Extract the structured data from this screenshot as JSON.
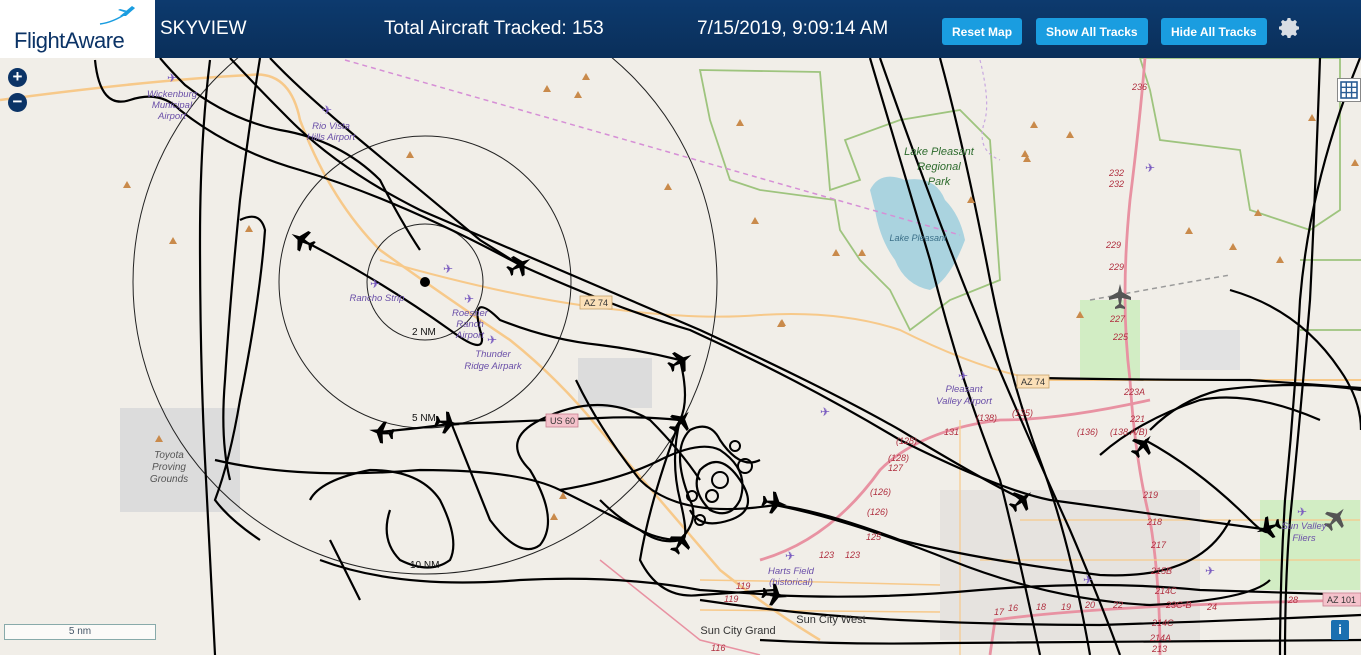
{
  "header": {
    "logo_text": "FlightAware",
    "app_name": "SKYVIEW",
    "total_tracked": "Total Aircraft Tracked: 153",
    "timestamp": "7/15/2019, 9:09:14 AM",
    "reset_label": "Reset Map",
    "show_tracks_label": "Show All Tracks",
    "hide_tracks_label": "Hide All Tracks",
    "settings_icon": "gear-icon"
  },
  "map_controls": {
    "zoom_in": "+",
    "zoom_out": "−",
    "scale_label": "5 nm",
    "info_label": "i",
    "layers_icon": "grid-icon"
  },
  "range_rings": [
    "2 NM",
    "5 NM",
    "10 NM"
  ],
  "places": {
    "wickenburg": [
      "Wickenburg",
      "Municipal",
      "Airport"
    ],
    "rio_vista": [
      "Rio Vista",
      "Hills Airport"
    ],
    "rancho": "Rancho Strip",
    "roesner": [
      "Roesner",
      "Ranch",
      "Airport"
    ],
    "thunder": [
      "Thunder",
      "Ridge Airpark"
    ],
    "toyota": [
      "Toyota",
      "Proving",
      "Grounds"
    ],
    "lake_park": [
      "Lake Pleasant",
      "Regional",
      "Park"
    ],
    "lake": "Lake Pleasant",
    "pleasant_valley": [
      "Pleasant",
      "Valley Airport"
    ],
    "harts": [
      "Harts Field",
      "(historical)"
    ],
    "sun_valley": [
      "Sun Valley",
      "Fliers"
    ],
    "sun_city_grand": "Sun City Grand",
    "sun_city_west": "Sun City West"
  },
  "road_labels": {
    "az74_a": "AZ 74",
    "az74_b": "AZ 74",
    "us60": "US 60",
    "az101": "AZ 101"
  },
  "mile_markers": [
    "236",
    "232",
    "232",
    "229",
    "229",
    "227",
    "225",
    "223A",
    "221",
    "219",
    "218",
    "217",
    "215B",
    "214C",
    "214C",
    "214A",
    "213",
    "(136)",
    "(138 A/B)",
    "(135)",
    "(138)",
    "131",
    "(128)",
    "(128)",
    "127",
    "(126)",
    "(126)",
    "125",
    "123",
    "123",
    "119",
    "119",
    "116",
    "17",
    "16",
    "18",
    "19",
    "20",
    "22",
    "23C-B",
    "24",
    "28"
  ],
  "colors": {
    "header_bg": "#0a2f5a",
    "button_bg": "#1a9de0",
    "map_bg": "#f1eee8",
    "track": "#000000",
    "water": "#aad3df",
    "park_border": "#9ec47e",
    "highway": "#e892a2",
    "road": "#f7c98a"
  }
}
